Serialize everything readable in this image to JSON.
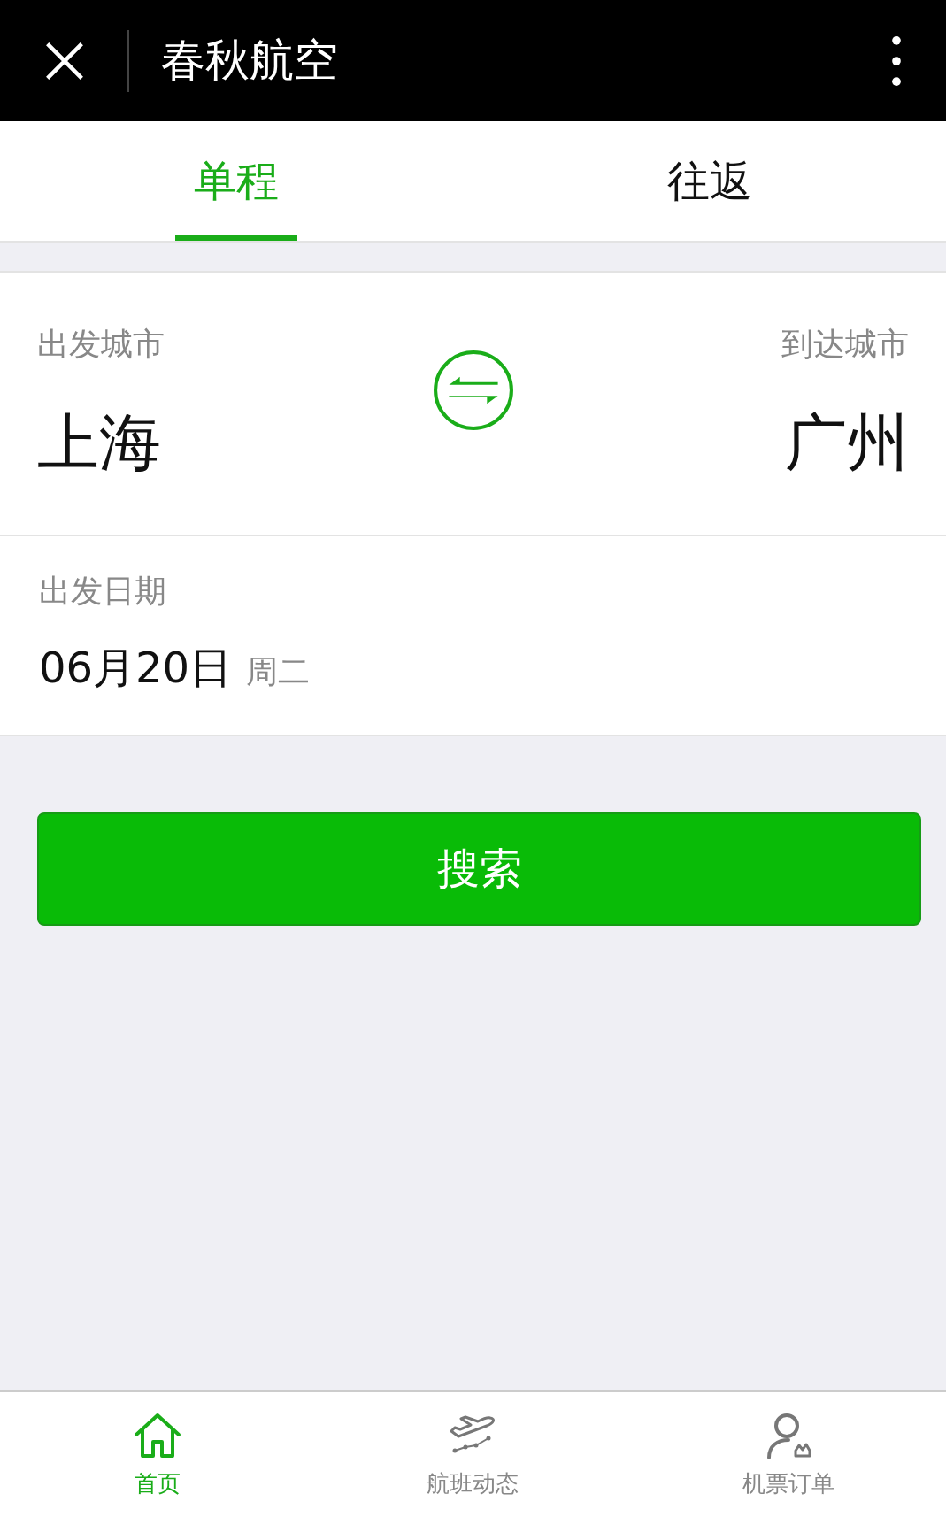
{
  "header": {
    "title": "春秋航空"
  },
  "tabs": [
    {
      "label": "单程",
      "selected": true
    },
    {
      "label": "往返",
      "selected": false
    }
  ],
  "route": {
    "from_label": "出发城市",
    "from_city": "上海",
    "to_label": "到达城市",
    "to_city": "广州"
  },
  "date": {
    "label": "出发日期",
    "value": "06月20日",
    "weekday": "周二"
  },
  "search_button": "搜索",
  "bottom_nav": [
    {
      "label": "首页",
      "kind": "home",
      "selected": true
    },
    {
      "label": "航班动态",
      "kind": "flight",
      "selected": false
    },
    {
      "label": "机票订单",
      "kind": "orders",
      "selected": false
    }
  ]
}
